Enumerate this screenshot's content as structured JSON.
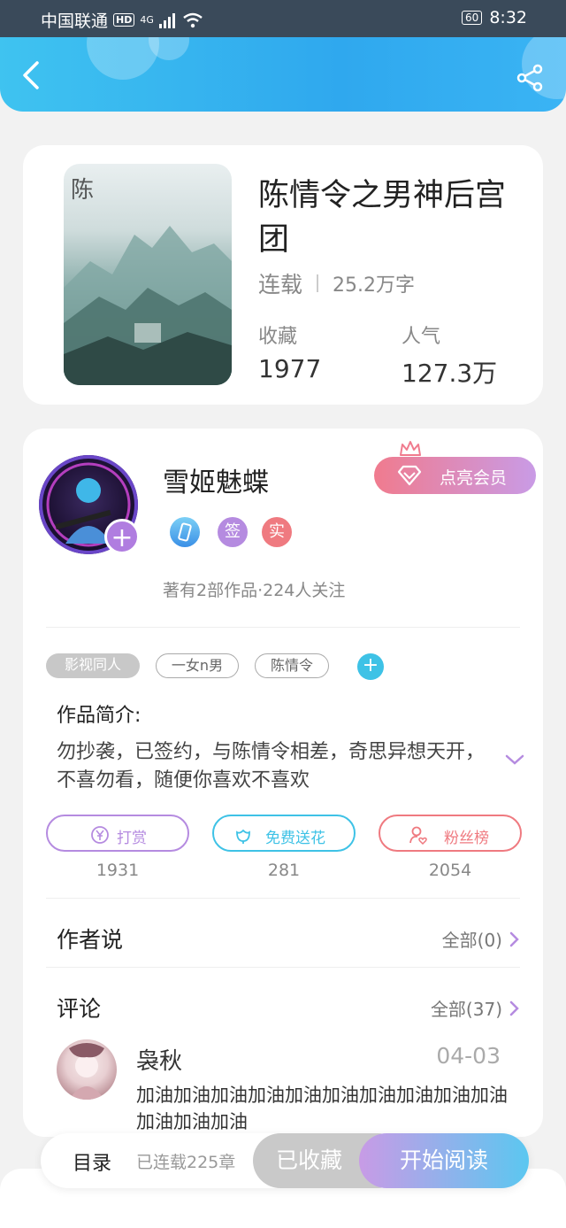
{
  "status_bar": {
    "carrier": "中国联通",
    "hd": "HD",
    "network": "4G",
    "battery": "60",
    "time": "8:32"
  },
  "header": {
    "back_icon": "chevron-left-icon",
    "share_icon": "share-icon"
  },
  "book": {
    "title": "陈情令之男神后宫团",
    "status": "连载",
    "word_count": "25.2万字",
    "favorites_label": "收藏",
    "favorites_value": "1977",
    "popularity_label": "人气",
    "popularity_value": "127.3万"
  },
  "author": {
    "name": "雪姬魅蝶",
    "vip_button": "点亮会员",
    "badges": [
      "签",
      "实"
    ],
    "stats": "著有2部作品·224人关注"
  },
  "tags": [
    "影视同人",
    "一女n男",
    "陈情令"
  ],
  "intro": {
    "title": "作品简介:",
    "text": "勿抄袭，已签约，与陈情令相差，奇思异想天开，不喜勿看，随便你喜欢不喜欢"
  },
  "actions": [
    {
      "label": "打赏",
      "count": "1931",
      "color": "#b58be0",
      "icon": "yuan-coin-icon"
    },
    {
      "label": "免费送花",
      "count": "281",
      "color": "#3ec2e6",
      "icon": "flower-icon"
    },
    {
      "label": "粉丝榜",
      "count": "2054",
      "color": "#ef7a80",
      "icon": "fan-user-icon"
    }
  ],
  "author_says": {
    "title": "作者说",
    "more": "全部(0)"
  },
  "comments": {
    "title": "评论",
    "more": "全部(37)",
    "first": {
      "user": "袅秋",
      "date": "04-03",
      "text": "加油加油加油加油加油加油加油加油加油加油加油加油加油"
    }
  },
  "bottom_bar": {
    "toc": "目录",
    "serial": "已连载225章",
    "collected": "已收藏",
    "read": "开始阅读"
  }
}
